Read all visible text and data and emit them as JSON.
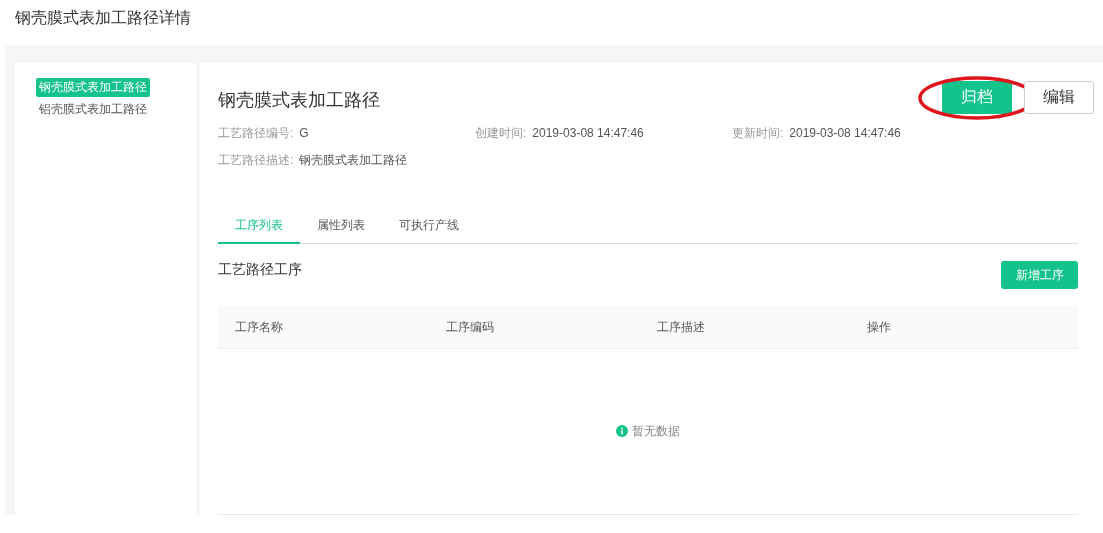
{
  "page_title": "钢壳膜式表加工路径详情",
  "sidebar": {
    "items": [
      {
        "label": "钢壳膜式表加工路径",
        "selected": true
      },
      {
        "label": "铝壳膜式表加工路径",
        "selected": false
      }
    ]
  },
  "detail": {
    "title": "钢壳膜式表加工路径",
    "buttons": [
      {
        "label": "归档",
        "kind": "primary",
        "highlighted": true
      },
      {
        "label": "编辑",
        "kind": "default",
        "highlighted": false
      }
    ],
    "fields": [
      {
        "label": "工艺路径编号:",
        "value": "G"
      },
      {
        "label": "创建时间:",
        "value": "2019-03-08 14:47:46"
      },
      {
        "label": "更新时间:",
        "value": "2019-03-08 14:47:46"
      },
      {
        "label": "工艺路径描述:",
        "value": "钢壳膜式表加工路径"
      }
    ]
  },
  "tabs": [
    {
      "label": "工序列表",
      "selected": true
    },
    {
      "label": "属性列表",
      "selected": false
    },
    {
      "label": "可执行产线",
      "selected": false
    }
  ],
  "section": {
    "title": "工艺路径工序",
    "add_button": "新增工序"
  },
  "table": {
    "columns": [
      "工序名称",
      "工序编码",
      "工序描述",
      "操作"
    ],
    "empty_text": "暂无数据"
  }
}
